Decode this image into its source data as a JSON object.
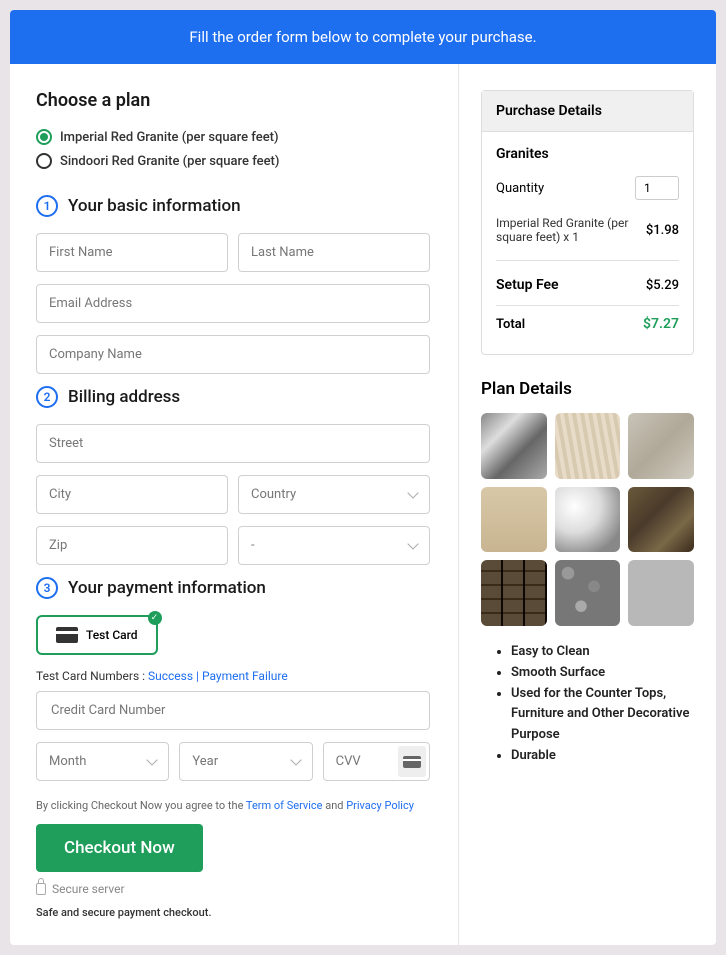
{
  "banner": "Fill the order form below to complete your purchase.",
  "plan": {
    "title": "Choose a plan",
    "options": [
      "Imperial Red Granite (per square feet)",
      "Sindoori Red Granite (per square feet)"
    ]
  },
  "s1": {
    "num": "1",
    "title": "Your basic information"
  },
  "inputs": {
    "first": "First Name",
    "last": "Last Name",
    "email": "Email Address",
    "company": "Company Name"
  },
  "s2": {
    "num": "2",
    "title": "Billing address"
  },
  "billing": {
    "street": "Street",
    "city": "City",
    "country": "Country",
    "zip": "Zip",
    "state": "-"
  },
  "s3": {
    "num": "3",
    "title": "Your payment information"
  },
  "card": {
    "label": "Test Card"
  },
  "test": {
    "prefix": "Test Card Numbers : ",
    "success": "Success",
    "failure": "Payment Failure"
  },
  "cc": {
    "num": "Credit Card Number",
    "month": "Month",
    "year": "Year",
    "cvv": "CVV"
  },
  "agree": {
    "a": "By clicking Checkout Now you agree to the ",
    "tos": "Term of Service",
    "and": " and ",
    "pp": "Privacy Policy"
  },
  "checkout": "Checkout Now",
  "secure": "Secure server",
  "safe": "Safe and secure payment checkout.",
  "purchase": {
    "head": "Purchase Details",
    "sub": "Granites",
    "qty_label": "Quantity",
    "qty_val": "1",
    "line_desc": "Imperial Red Granite (per square feet) x 1",
    "line_price": "$1.98",
    "setup_label": "Setup Fee",
    "setup_price": "$5.29",
    "total_label": "Total",
    "total_price": "$7.27"
  },
  "pd": {
    "title": "Plan Details"
  },
  "bullets": [
    "Easy to Clean",
    "Smooth Surface",
    "Used for the Counter Tops, Furniture and Other Decorative Purpose",
    "Durable"
  ]
}
